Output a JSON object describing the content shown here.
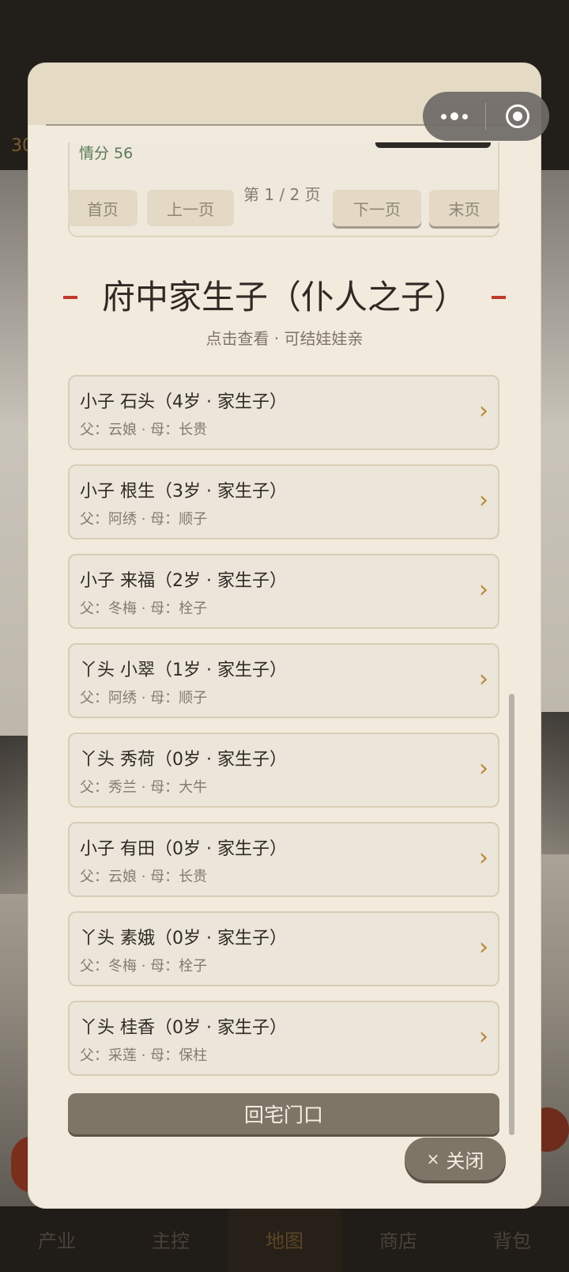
{
  "background": {
    "top_text": "30"
  },
  "bottom_nav": {
    "items": [
      {
        "label": "产业"
      },
      {
        "label": "主控"
      },
      {
        "label": "地图"
      },
      {
        "label": "商店"
      },
      {
        "label": "背包"
      }
    ]
  },
  "prev_card": {
    "affection": "情分 56"
  },
  "pagination": {
    "first": "首页",
    "prev": "上一页",
    "page_info": "第 1 / 2 页",
    "next": "下一页",
    "last": "末页",
    "current_page": 1,
    "total_pages": 2
  },
  "section": {
    "title": "府中家生子（仆人之子）",
    "subtitle": "点击查看 · 可结娃娃亲"
  },
  "children": [
    {
      "name": "小子 石头（4岁 · 家生子）",
      "parents": "父：云娘 · 母：长贵"
    },
    {
      "name": "小子 根生（3岁 · 家生子）",
      "parents": "父：阿绣 · 母：顺子"
    },
    {
      "name": "小子 来福（2岁 · 家生子）",
      "parents": "父：冬梅 · 母：栓子"
    },
    {
      "name": "丫头 小翠（1岁 · 家生子）",
      "parents": "父：阿绣 · 母：顺子"
    },
    {
      "name": "丫头 秀荷（0岁 · 家生子）",
      "parents": "父：秀兰 · 母：大牛"
    },
    {
      "name": "小子 有田（0岁 · 家生子）",
      "parents": "父：云娘 · 母：长贵"
    },
    {
      "name": "丫头 素娥（0岁 · 家生子）",
      "parents": "父：冬梅 · 母：栓子"
    },
    {
      "name": "丫头 桂香（0岁 · 家生子）",
      "parents": "父：采莲 · 母：保柱"
    }
  ],
  "chevron": "›",
  "back_button": "回宅门口",
  "close_button": {
    "icon": "×",
    "label": "关闭"
  },
  "colors": {
    "modal_bg": "#f2ebdd",
    "accent_red": "#c0392b",
    "chevron_gold": "#b9863a",
    "button_brown": "#7f7567",
    "affection_green": "#5b7a55"
  }
}
